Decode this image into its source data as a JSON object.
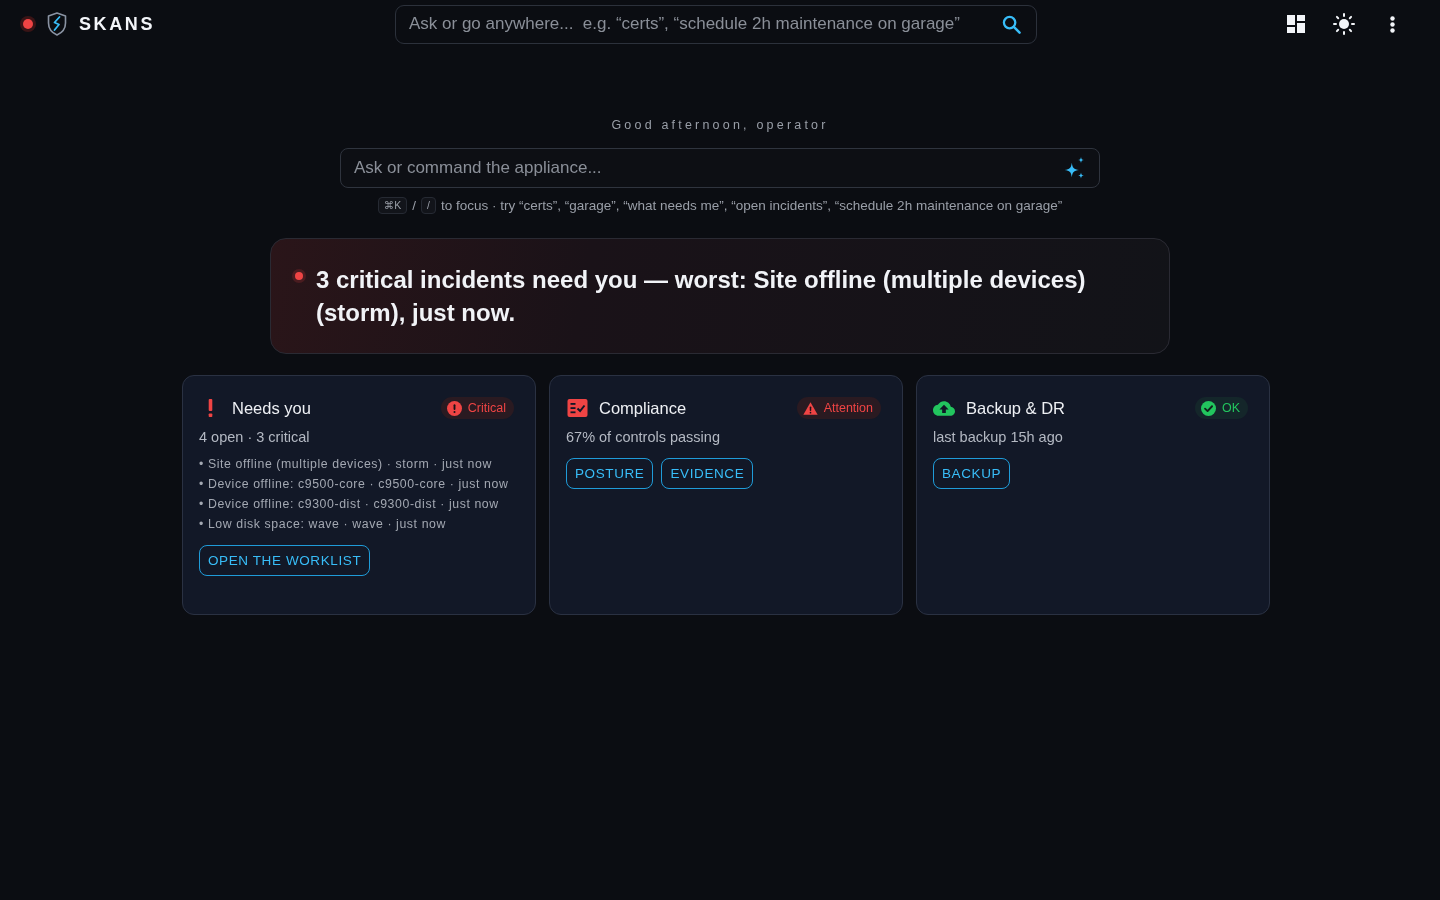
{
  "top_bar": {
    "brand": "SKANS",
    "search": {
      "placeholder": "Ask or go anywhere...  e.g. “certs”, “schedule 2h maintenance on garage”"
    }
  },
  "greeting": "Good afternoon, operator",
  "command": {
    "placeholder": "Ask or command the appliance..."
  },
  "hint": {
    "keys": [
      "⌘K",
      "/"
    ],
    "separator": "/",
    "text": "to focus · try “certs”, “garage”, “what needs me”, “open incidents”, “schedule 2h maintenance on garage”"
  },
  "alert": {
    "text": "3 critical incidents need you — worst: Site offline (multiple devices) (storm), just now."
  },
  "cards": [
    {
      "kind": "incidents",
      "title": "Needs you",
      "status": {
        "label": "Critical",
        "kind": "critical"
      },
      "summary": "4 open · 3 critical",
      "items": [
        "• Site offline (multiple devices) · storm · just now",
        "• Device offline: c9500-core · c9500-core · just now",
        "• Device offline: c9300-dist · c9300-dist · just now",
        "• Low disk space: wave · wave · just now"
      ],
      "actions": [
        "OPEN THE WORKLIST"
      ]
    },
    {
      "kind": "compliance",
      "title": "Compliance",
      "status": {
        "label": "Attention",
        "kind": "attention"
      },
      "summary": "67% of controls passing",
      "actions": [
        "POSTURE",
        "EVIDENCE"
      ]
    },
    {
      "kind": "backup",
      "title": "Backup & DR",
      "status": {
        "label": "OK",
        "kind": "ok"
      },
      "summary": "last backup 15h ago",
      "actions": [
        "BACKUP"
      ]
    }
  ]
}
